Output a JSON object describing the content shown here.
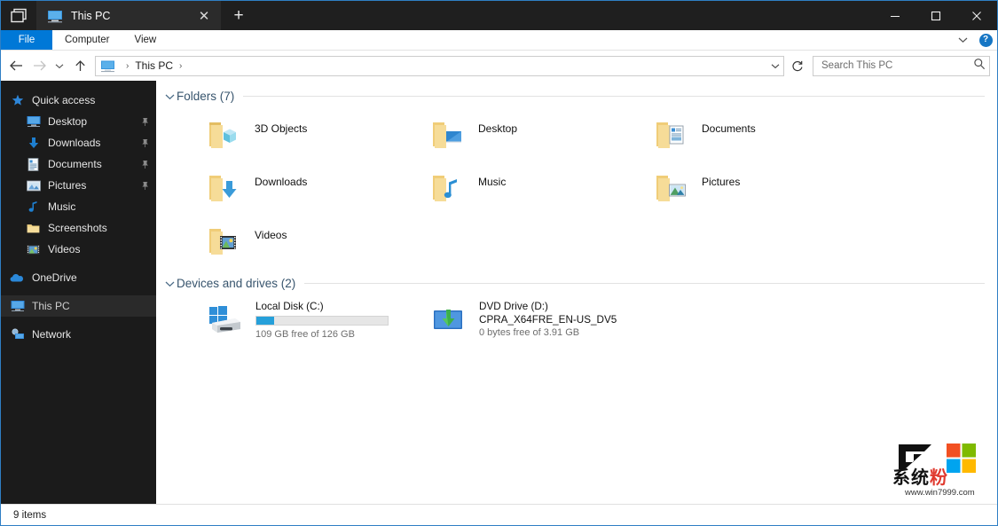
{
  "window": {
    "app_icon": "explorer-tabs-icon",
    "tab": {
      "title": "This PC",
      "icon": "this-pc-monitor-icon",
      "close_label": "✕"
    },
    "new_tab_label": "+",
    "controls": {
      "minimize": "minimize-icon",
      "maximize": "maximize-icon",
      "close": "close-icon"
    }
  },
  "ribbon": {
    "file_label": "File",
    "tabs": [
      "Computer",
      "View"
    ],
    "expand_icon": "chevron-down-icon",
    "help_label": "?"
  },
  "nav": {
    "back_icon": "back-arrow-icon",
    "forward_icon": "forward-arrow-icon",
    "recent_icon": "chevron-down-icon",
    "up_icon": "up-arrow-icon",
    "breadcrumb": {
      "icon": "this-pc-monitor-icon",
      "text": "This PC",
      "separator": "›"
    },
    "dropdown_icon": "chevron-down-icon",
    "refresh_icon": "refresh-icon"
  },
  "search": {
    "placeholder": "Search This PC",
    "value": "",
    "icon": "search-icon"
  },
  "sidebar": {
    "items": [
      {
        "label": "Quick access",
        "icon": "star-icon",
        "indent": false,
        "pinned": false,
        "selected": false
      },
      {
        "label": "Desktop",
        "icon": "desktop-monitor-icon",
        "indent": true,
        "pinned": true,
        "selected": false
      },
      {
        "label": "Downloads",
        "icon": "download-arrow-icon",
        "indent": true,
        "pinned": true,
        "selected": false
      },
      {
        "label": "Documents",
        "icon": "document-icon",
        "indent": true,
        "pinned": true,
        "selected": false
      },
      {
        "label": "Pictures",
        "icon": "picture-icon",
        "indent": true,
        "pinned": true,
        "selected": false
      },
      {
        "label": "Music",
        "icon": "music-note-icon",
        "indent": true,
        "pinned": false,
        "selected": false
      },
      {
        "label": "Screenshots",
        "icon": "folder-icon",
        "indent": true,
        "pinned": false,
        "selected": false
      },
      {
        "label": "Videos",
        "icon": "video-film-icon",
        "indent": true,
        "pinned": false,
        "selected": false
      },
      {
        "label": "OneDrive",
        "icon": "cloud-icon",
        "indent": false,
        "pinned": false,
        "selected": false,
        "gap_before": true
      },
      {
        "label": "This PC",
        "icon": "this-pc-monitor-icon",
        "indent": false,
        "pinned": false,
        "selected": true,
        "gap_before": true
      },
      {
        "label": "Network",
        "icon": "network-icon",
        "indent": false,
        "pinned": false,
        "selected": false,
        "gap_before": true
      }
    ]
  },
  "content": {
    "folders_group": {
      "title": "Folders (7)",
      "chevron": "chevron-down-icon",
      "items": [
        {
          "label": "3D Objects",
          "icon": "folder-3d-objects-icon"
        },
        {
          "label": "Desktop",
          "icon": "folder-desktop-icon"
        },
        {
          "label": "Documents",
          "icon": "folder-documents-icon"
        },
        {
          "label": "Downloads",
          "icon": "folder-downloads-icon"
        },
        {
          "label": "Music",
          "icon": "folder-music-icon"
        },
        {
          "label": "Pictures",
          "icon": "folder-pictures-icon"
        },
        {
          "label": "Videos",
          "icon": "folder-videos-icon"
        }
      ]
    },
    "drives_group": {
      "title": "Devices and drives (2)",
      "chevron": "chevron-down-icon",
      "items": [
        {
          "name": "Local Disk (C:)",
          "name2": "",
          "free_text": "109 GB free of 126 GB",
          "used_percent": 13.5,
          "icon": "hard-disk-windows-icon",
          "has_bar": true
        },
        {
          "name": "DVD Drive (D:)",
          "name2": "CPRA_X64FRE_EN-US_DV5",
          "free_text": "0 bytes free of 3.91 GB",
          "used_percent": 100,
          "icon": "dvd-drive-icon",
          "has_bar": false
        }
      ]
    }
  },
  "watermark": {
    "brand_cn_black": "系统",
    "brand_cn_red": "粉",
    "url": "www.win7999.com"
  },
  "statusbar": {
    "items_text": "9 items"
  },
  "colors": {
    "accent": "#0078d7",
    "titlebar": "#1f1f1f",
    "sidebar": "#1b1b1b",
    "progress": "#26a0da",
    "group_header": "#37546d"
  }
}
